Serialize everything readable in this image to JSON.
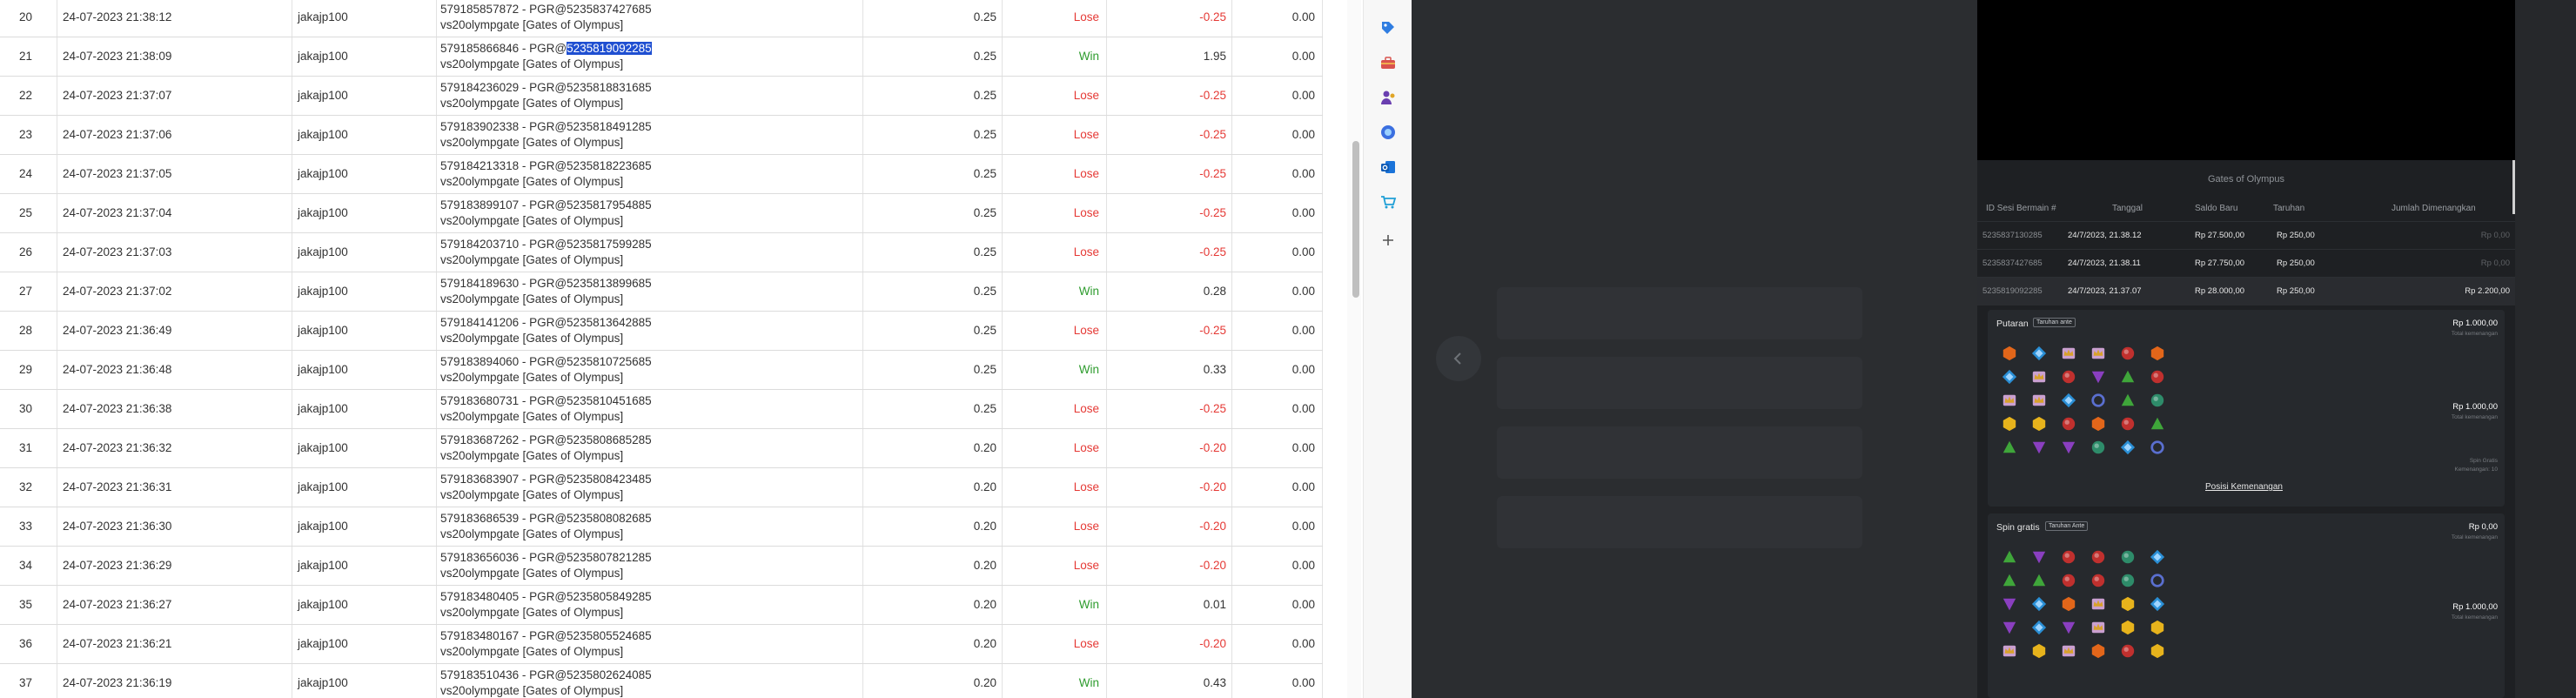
{
  "table": {
    "rows": [
      {
        "no": "20",
        "date": "24-07-2023 21:38:12",
        "user": "jakajp100",
        "desc_line1": "579185857872 - PGR@5235837427685",
        "desc_line2": "vs20olympgate [Gates of Olympus]",
        "bet": "0.25",
        "result": "Lose",
        "win": "-0.25",
        "balance": "0.00"
      },
      {
        "no": "21",
        "date": "24-07-2023 21:38:09",
        "user": "jakajp100",
        "desc_prefix": "579185866846 - PGR@",
        "desc_selected": "5235819092285",
        "desc_line2": "vs20olympgate [Gates of Olympus]",
        "bet": "0.25",
        "result": "Win",
        "win": "1.95",
        "balance": "0.00"
      },
      {
        "no": "22",
        "date": "24-07-2023 21:37:07",
        "user": "jakajp100",
        "desc_line1": "579184236029 - PGR@5235818831685",
        "desc_line2": "vs20olympgate [Gates of Olympus]",
        "bet": "0.25",
        "result": "Lose",
        "win": "-0.25",
        "balance": "0.00"
      },
      {
        "no": "23",
        "date": "24-07-2023 21:37:06",
        "user": "jakajp100",
        "desc_line1": "579183902338 - PGR@5235818491285",
        "desc_line2": "vs20olympgate [Gates of Olympus]",
        "bet": "0.25",
        "result": "Lose",
        "win": "-0.25",
        "balance": "0.00"
      },
      {
        "no": "24",
        "date": "24-07-2023 21:37:05",
        "user": "jakajp100",
        "desc_line1": "579184213318 - PGR@5235818223685",
        "desc_line2": "vs20olympgate [Gates of Olympus]",
        "bet": "0.25",
        "result": "Lose",
        "win": "-0.25",
        "balance": "0.00"
      },
      {
        "no": "25",
        "date": "24-07-2023 21:37:04",
        "user": "jakajp100",
        "desc_line1": "579183899107 - PGR@5235817954885",
        "desc_line2": "vs20olympgate [Gates of Olympus]",
        "bet": "0.25",
        "result": "Lose",
        "win": "-0.25",
        "balance": "0.00"
      },
      {
        "no": "26",
        "date": "24-07-2023 21:37:03",
        "user": "jakajp100",
        "desc_line1": "579184203710 - PGR@5235817599285",
        "desc_line2": "vs20olympgate [Gates of Olympus]",
        "bet": "0.25",
        "result": "Lose",
        "win": "-0.25",
        "balance": "0.00"
      },
      {
        "no": "27",
        "date": "24-07-2023 21:37:02",
        "user": "jakajp100",
        "desc_line1": "579184189630 - PGR@5235813899685",
        "desc_line2": "vs20olympgate [Gates of Olympus]",
        "bet": "0.25",
        "result": "Win",
        "win": "0.28",
        "balance": "0.00"
      },
      {
        "no": "28",
        "date": "24-07-2023 21:36:49",
        "user": "jakajp100",
        "desc_line1": "579184141206 - PGR@5235813642885",
        "desc_line2": "vs20olympgate [Gates of Olympus]",
        "bet": "0.25",
        "result": "Lose",
        "win": "-0.25",
        "balance": "0.00"
      },
      {
        "no": "29",
        "date": "24-07-2023 21:36:48",
        "user": "jakajp100",
        "desc_line1": "579183894060 - PGR@5235810725685",
        "desc_line2": "vs20olympgate [Gates of Olympus]",
        "bet": "0.25",
        "result": "Win",
        "win": "0.33",
        "balance": "0.00"
      },
      {
        "no": "30",
        "date": "24-07-2023 21:36:38",
        "user": "jakajp100",
        "desc_line1": "579183680731 - PGR@5235810451685",
        "desc_line2": "vs20olympgate [Gates of Olympus]",
        "bet": "0.25",
        "result": "Lose",
        "win": "-0.25",
        "balance": "0.00"
      },
      {
        "no": "31",
        "date": "24-07-2023 21:36:32",
        "user": "jakajp100",
        "desc_line1": "579183687262 - PGR@5235808685285",
        "desc_line2": "vs20olympgate [Gates of Olympus]",
        "bet": "0.20",
        "result": "Lose",
        "win": "-0.20",
        "balance": "0.00"
      },
      {
        "no": "32",
        "date": "24-07-2023 21:36:31",
        "user": "jakajp100",
        "desc_line1": "579183683907 - PGR@5235808423485",
        "desc_line2": "vs20olympgate [Gates of Olympus]",
        "bet": "0.20",
        "result": "Lose",
        "win": "-0.20",
        "balance": "0.00"
      },
      {
        "no": "33",
        "date": "24-07-2023 21:36:30",
        "user": "jakajp100",
        "desc_line1": "579183686539 - PGR@5235808082685",
        "desc_line2": "vs20olympgate [Gates of Olympus]",
        "bet": "0.20",
        "result": "Lose",
        "win": "-0.20",
        "balance": "0.00"
      },
      {
        "no": "34",
        "date": "24-07-2023 21:36:29",
        "user": "jakajp100",
        "desc_line1": "579183656036 - PGR@5235807821285",
        "desc_line2": "vs20olympgate [Gates of Olympus]",
        "bet": "0.20",
        "result": "Lose",
        "win": "-0.20",
        "balance": "0.00"
      },
      {
        "no": "35",
        "date": "24-07-2023 21:36:27",
        "user": "jakajp100",
        "desc_line1": "579183480405 - PGR@5235805849285",
        "desc_line2": "vs20olympgate [Gates of Olympus]",
        "bet": "0.20",
        "result": "Win",
        "win": "0.01",
        "balance": "0.00"
      },
      {
        "no": "36",
        "date": "24-07-2023 21:36:21",
        "user": "jakajp100",
        "desc_line1": "579183480167 - PGR@5235805524685",
        "desc_line2": "vs20olympgate [Gates of Olympus]",
        "bet": "0.20",
        "result": "Lose",
        "win": "-0.20",
        "balance": "0.00"
      },
      {
        "no": "37",
        "date": "24-07-2023 21:36:19",
        "user": "jakajp100",
        "desc_line1": "579183510436 - PGR@5235802624085",
        "desc_line2": "vs20olympgate [Gates of Olympus]",
        "bet": "0.20",
        "result": "Win",
        "win": "0.43",
        "balance": "0.00"
      }
    ]
  },
  "edge_sidebar": {
    "icons": [
      "tag-icon",
      "toolbox-icon",
      "games-icon",
      "copilot-icon",
      "outlook-icon",
      "shopping-icon",
      "add-icon"
    ]
  },
  "game_panel": {
    "title": "Gates of Olympus",
    "headers": {
      "id": "ID Sesi Bermain #",
      "date": "Tanggal",
      "balance": "Saldo Baru",
      "bet": "Taruhan",
      "winnings": "Jumlah Dimenangkan"
    },
    "history": [
      {
        "id": "5235837130285",
        "date": "24/7/2023, 21.38.12",
        "balance": "Rp 27.500,00",
        "bet": "Rp 250,00",
        "win": "Rp 0,00"
      },
      {
        "id": "5235837427685",
        "date": "24/7/2023, 21.38.11",
        "balance": "Rp 27.750,00",
        "bet": "Rp 250,00",
        "win": "Rp 0,00"
      },
      {
        "id": "5235819092285",
        "date": "24/7/2023, 21.37.07",
        "balance": "Rp 28.000,00",
        "bet": "Rp 250,00",
        "win": "Rp 2.200,00"
      }
    ],
    "spin_card": {
      "title": "Putaran",
      "tag": "Taruhan ante",
      "amount_top": "Rp 1.000,00",
      "sub_top": "Total kemenangan",
      "amount_mid": "Rp 1.000,00",
      "sub_mid": "Total kemenangan",
      "sub_bottom1": "Spin Gratis",
      "sub_bottom2": "Kemenangan: 10",
      "link": "Posisi Kemenangan"
    },
    "free_card": {
      "title": "Spin gratis",
      "tag": "Taruhan Ante",
      "amount_top": "Rp 0,00",
      "sub_top": "Total kemenangan",
      "amount_mid": "Rp 1.000,00",
      "sub_mid": "Total kemenangan"
    },
    "colors": {
      "lose": "#e53935",
      "win": "#2e9c2e",
      "selection": "#1f4fd1",
      "panel_bg": "#1e2023"
    }
  }
}
